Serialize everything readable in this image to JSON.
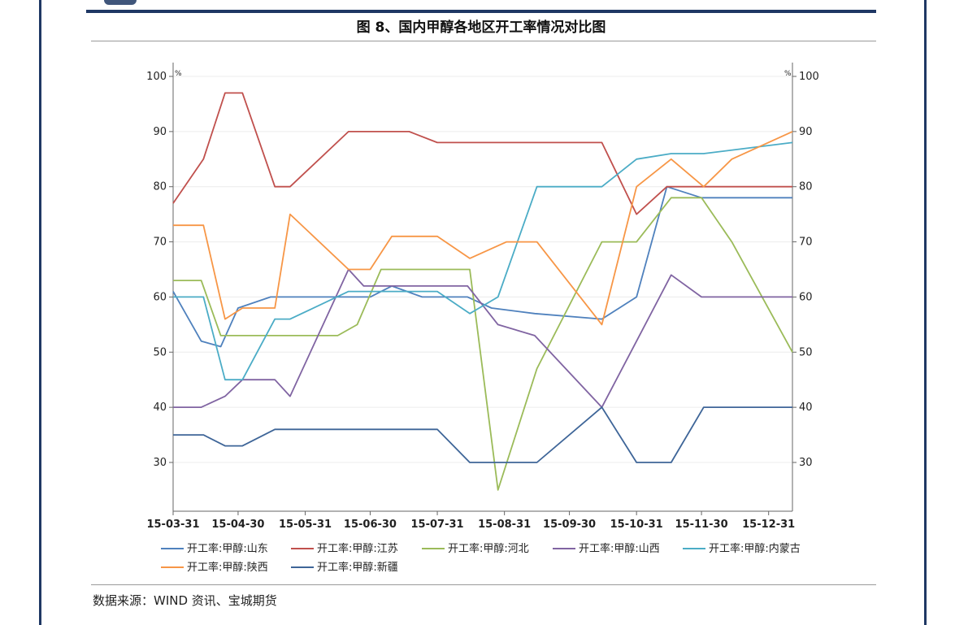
{
  "figure_title": "图 8、国内甲醇各地区开工率情况对比图",
  "source_note": "数据来源：WIND 资讯、宝城期货",
  "chart_data": {
    "type": "line",
    "title": "",
    "y_unit_left": "%",
    "y_unit_right": "%",
    "ylim": [
      22,
      100
    ],
    "y_ticks": [
      30,
      40,
      50,
      60,
      70,
      80,
      90,
      100
    ],
    "x_tick_labels": [
      "15-03-31",
      "15-04-30",
      "15-05-31",
      "15-06-30",
      "15-07-31",
      "15-08-31",
      "15-09-30",
      "15-10-31",
      "15-11-30",
      "15-12-31"
    ],
    "x_tick_dates": [
      "2015-03-31",
      "2015-04-30",
      "2015-05-31",
      "2015-06-30",
      "2015-07-31",
      "2015-08-31",
      "2015-09-30",
      "2015-10-31",
      "2015-11-30",
      "2015-12-31"
    ],
    "xlim": [
      "2015-03-31",
      "2016-01-11"
    ],
    "grid": "horizontal",
    "legend_position": "bottom",
    "series": [
      {
        "name": "开工率:甲醇:山东",
        "color": "#4f81bd",
        "points": [
          [
            "2015-03-31",
            61
          ],
          [
            "2015-04-13",
            52
          ],
          [
            "2015-04-22",
            51
          ],
          [
            "2015-04-30",
            58
          ],
          [
            "2015-05-15",
            60
          ],
          [
            "2015-06-30",
            60
          ],
          [
            "2015-07-10",
            62
          ],
          [
            "2015-07-24",
            60
          ],
          [
            "2015-08-14",
            60
          ],
          [
            "2015-08-25",
            58
          ],
          [
            "2015-09-14",
            57
          ],
          [
            "2015-10-15",
            56
          ],
          [
            "2015-10-31",
            60
          ],
          [
            "2015-11-14",
            80
          ],
          [
            "2015-11-30",
            78
          ],
          [
            "2016-01-11",
            78
          ]
        ]
      },
      {
        "name": "开工率:甲醇:江苏",
        "color": "#c0504d",
        "points": [
          [
            "2015-03-31",
            77
          ],
          [
            "2015-04-14",
            85
          ],
          [
            "2015-04-24",
            97
          ],
          [
            "2015-05-02",
            97
          ],
          [
            "2015-05-17",
            80
          ],
          [
            "2015-05-24",
            80
          ],
          [
            "2015-06-20",
            90
          ],
          [
            "2015-07-18",
            90
          ],
          [
            "2015-07-31",
            88
          ],
          [
            "2015-10-15",
            88
          ],
          [
            "2015-10-31",
            75
          ],
          [
            "2015-11-14",
            80
          ],
          [
            "2016-01-11",
            80
          ]
        ]
      },
      {
        "name": "开工率:甲醇:河北",
        "color": "#9bbb59",
        "points": [
          [
            "2015-03-31",
            63
          ],
          [
            "2015-04-13",
            63
          ],
          [
            "2015-04-22",
            53
          ],
          [
            "2015-06-15",
            53
          ],
          [
            "2015-06-24",
            55
          ],
          [
            "2015-07-05",
            65
          ],
          [
            "2015-08-15",
            65
          ],
          [
            "2015-08-28",
            25
          ],
          [
            "2015-09-15",
            47
          ],
          [
            "2015-10-15",
            70
          ],
          [
            "2015-10-31",
            70
          ],
          [
            "2015-11-16",
            78
          ],
          [
            "2015-11-30",
            78
          ],
          [
            "2015-12-14",
            70
          ],
          [
            "2016-01-11",
            50
          ]
        ]
      },
      {
        "name": "开工率:甲醇:山西",
        "color": "#8064a2",
        "points": [
          [
            "2015-03-31",
            40
          ],
          [
            "2015-04-13",
            40
          ],
          [
            "2015-04-24",
            42
          ],
          [
            "2015-05-02",
            45
          ],
          [
            "2015-05-17",
            45
          ],
          [
            "2015-05-24",
            42
          ],
          [
            "2015-06-20",
            65
          ],
          [
            "2015-06-27",
            62
          ],
          [
            "2015-07-18",
            62
          ],
          [
            "2015-08-14",
            62
          ],
          [
            "2015-08-28",
            55
          ],
          [
            "2015-09-14",
            53
          ],
          [
            "2015-10-15",
            40
          ],
          [
            "2015-10-31",
            52
          ],
          [
            "2015-11-16",
            64
          ],
          [
            "2015-11-30",
            60
          ],
          [
            "2016-01-11",
            60
          ]
        ]
      },
      {
        "name": "开工率:甲醇:内蒙古",
        "color": "#4bacc6",
        "points": [
          [
            "2015-03-31",
            60
          ],
          [
            "2015-04-14",
            60
          ],
          [
            "2015-04-24",
            45
          ],
          [
            "2015-05-02",
            45
          ],
          [
            "2015-05-17",
            56
          ],
          [
            "2015-05-24",
            56
          ],
          [
            "2015-06-20",
            61
          ],
          [
            "2015-07-31",
            61
          ],
          [
            "2015-08-15",
            57
          ],
          [
            "2015-08-28",
            60
          ],
          [
            "2015-09-15",
            80
          ],
          [
            "2015-10-15",
            80
          ],
          [
            "2015-10-31",
            85
          ],
          [
            "2015-11-16",
            86
          ],
          [
            "2015-12-01",
            86
          ],
          [
            "2016-01-11",
            88
          ]
        ]
      },
      {
        "name": "开工率:甲醇:陕西",
        "color": "#f79646",
        "points": [
          [
            "2015-03-31",
            73
          ],
          [
            "2015-04-14",
            73
          ],
          [
            "2015-04-24",
            56
          ],
          [
            "2015-05-02",
            58
          ],
          [
            "2015-05-17",
            58
          ],
          [
            "2015-05-24",
            75
          ],
          [
            "2015-06-20",
            65
          ],
          [
            "2015-06-30",
            65
          ],
          [
            "2015-07-10",
            71
          ],
          [
            "2015-07-31",
            71
          ],
          [
            "2015-08-15",
            67
          ],
          [
            "2015-09-01",
            70
          ],
          [
            "2015-09-15",
            70
          ],
          [
            "2015-10-15",
            55
          ],
          [
            "2015-10-31",
            80
          ],
          [
            "2015-11-16",
            85
          ],
          [
            "2015-12-01",
            80
          ],
          [
            "2015-12-14",
            85
          ],
          [
            "2016-01-11",
            90
          ]
        ]
      },
      {
        "name": "开工率:甲醇:新疆",
        "color": "#3e6598",
        "points": [
          [
            "2015-03-31",
            35
          ],
          [
            "2015-04-14",
            35
          ],
          [
            "2015-04-24",
            33
          ],
          [
            "2015-05-02",
            33
          ],
          [
            "2015-05-17",
            36
          ],
          [
            "2015-07-31",
            36
          ],
          [
            "2015-08-15",
            30
          ],
          [
            "2015-09-15",
            30
          ],
          [
            "2015-10-15",
            40
          ],
          [
            "2015-10-31",
            30
          ],
          [
            "2015-11-16",
            30
          ],
          [
            "2015-12-01",
            40
          ],
          [
            "2016-01-11",
            40
          ]
        ]
      }
    ]
  }
}
